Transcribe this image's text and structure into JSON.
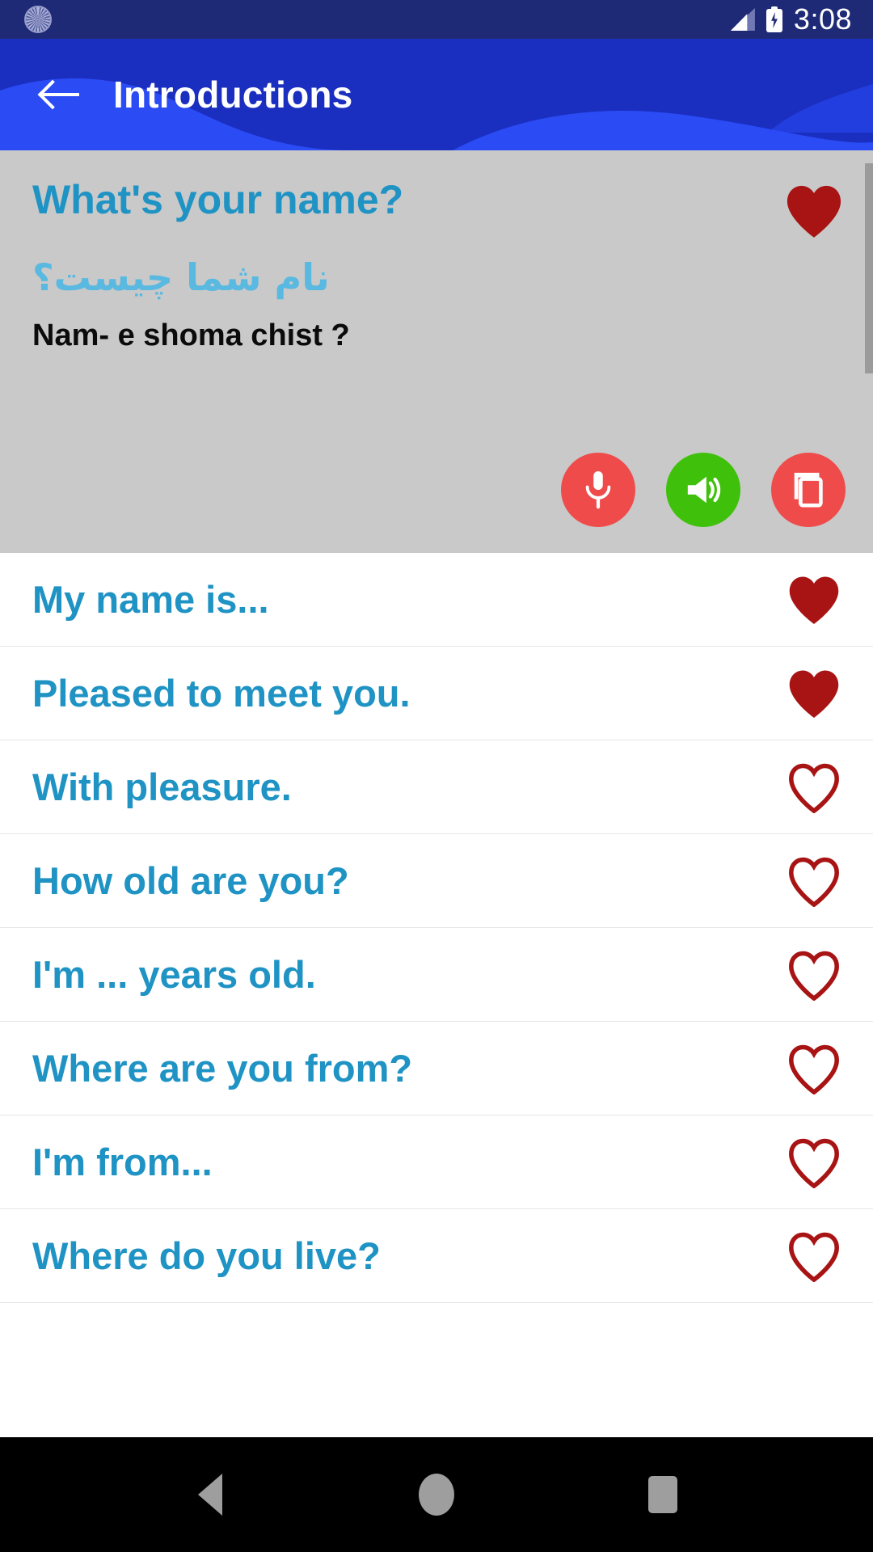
{
  "status_bar": {
    "time": "3:08",
    "icons": [
      "app-status-icon",
      "signal-icon",
      "battery-charging-icon"
    ],
    "background_color": "#1f2a76"
  },
  "app_bar": {
    "title": "Introductions",
    "back_icon": "arrow-back-icon",
    "background_color": "#1a2fc0",
    "wave_color": "#2b4bf5"
  },
  "featured_card": {
    "english": "What's your name?",
    "native": "نام شما چیست؟",
    "transliteration": "Nam- e shoma chist ?",
    "favorite": true,
    "favorite_icon": "heart-filled-icon",
    "background_color": "#c9c9c9",
    "english_color": "#1f93c4",
    "native_color": "#59b9e0",
    "transliteration_color": "#0b0b0b",
    "actions": [
      {
        "name": "record",
        "icon": "microphone-icon",
        "color": "#ef4b4b"
      },
      {
        "name": "play",
        "icon": "speaker-volume-icon",
        "color": "#3fc10c"
      },
      {
        "name": "copy",
        "icon": "copy-icon",
        "color": "#ef4b4b"
      }
    ]
  },
  "phrase_list": {
    "text_color": "#1f93c4",
    "heart_color": "#a81414",
    "items": [
      {
        "label": "My name is...",
        "favorite": true
      },
      {
        "label": "Pleased to meet you.",
        "favorite": true
      },
      {
        "label": "With pleasure.",
        "favorite": false
      },
      {
        "label": "How old are you?",
        "favorite": false
      },
      {
        "label": "I'm ... years old.",
        "favorite": false
      },
      {
        "label": "Where are you from?",
        "favorite": false
      },
      {
        "label": "I'm from...",
        "favorite": false
      },
      {
        "label": "Where do you live?",
        "favorite": false
      }
    ]
  },
  "nav_bar": {
    "background_color": "#000000",
    "buttons": [
      {
        "name": "back",
        "icon": "triangle-back-icon"
      },
      {
        "name": "home",
        "icon": "circle-home-icon"
      },
      {
        "name": "recents",
        "icon": "square-recents-icon"
      }
    ]
  }
}
